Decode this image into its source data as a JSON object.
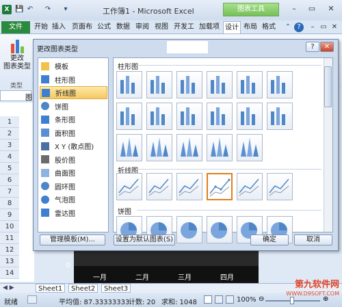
{
  "window": {
    "title": "工作簿1 - Microsoft Excel",
    "context_tab": "图表工具",
    "controls": [
      "–",
      "▭",
      "✕"
    ]
  },
  "quick_access": [
    "💾",
    "↶",
    "↷",
    "▾"
  ],
  "ribbon": {
    "tabs": [
      "文件",
      "开始",
      "插入",
      "页面布",
      "公式",
      "数据",
      "审阅",
      "视图",
      "开发工",
      "加载项",
      "设计",
      "布局",
      "格式"
    ],
    "active_tab": "设计",
    "change_type_button": "更改\n图表类型",
    "group_label": "类型"
  },
  "sheet": {
    "namebox": "图",
    "rows": [
      "1",
      "2",
      "3",
      "4",
      "5",
      "6",
      "7",
      "8",
      "9",
      "10",
      "11",
      "12",
      "13",
      "14"
    ],
    "chart_axis_zero": "0",
    "chart_months": [
      "一月",
      "二月",
      "三月",
      "四月"
    ],
    "tabs": [
      "Sheet1",
      "Sheet2",
      "Sheet3"
    ]
  },
  "status": {
    "mode": "就绪",
    "average": "平均值: 87.33333333",
    "count": "计数: 20",
    "sum": "求和: 1048",
    "zoom": "100%",
    "zoom_level": 1.0
  },
  "dialog": {
    "title": "更改图表类型",
    "help": "?",
    "close": "✕",
    "categories": [
      {
        "label": "模板",
        "icon": "folder-icon",
        "selected": false
      },
      {
        "label": "柱形图",
        "icon": "column-chart-icon",
        "selected": false
      },
      {
        "label": "折线图",
        "icon": "line-chart-icon",
        "selected": true
      },
      {
        "label": "饼图",
        "icon": "pie-chart-icon",
        "selected": false
      },
      {
        "label": "条形图",
        "icon": "bar-chart-icon",
        "selected": false
      },
      {
        "label": "面积图",
        "icon": "area-chart-icon",
        "selected": false
      },
      {
        "label": "X Y (散点图)",
        "icon": "scatter-chart-icon",
        "selected": false
      },
      {
        "label": "股价图",
        "icon": "stock-chart-icon",
        "selected": false
      },
      {
        "label": "曲面图",
        "icon": "surface-chart-icon",
        "selected": false
      },
      {
        "label": "圆环图",
        "icon": "doughnut-chart-icon",
        "selected": false
      },
      {
        "label": "气泡图",
        "icon": "bubble-chart-icon",
        "selected": false
      },
      {
        "label": "雷达图",
        "icon": "radar-chart-icon",
        "selected": false
      }
    ],
    "sections": [
      "柱形图",
      "折线图",
      "饼图"
    ],
    "manage_templates": "管理模板(M)...",
    "set_default": "设置为默认图表(S)",
    "ok": "确定",
    "cancel": "取消"
  },
  "watermark": {
    "text": "第九软件网",
    "url": "WWW.D9SOFT.COM"
  },
  "colors": {
    "accent": "#e07d1a",
    "file_tab": "#2a8a3e",
    "context_tab": "#76c058",
    "selected": "#f6c863"
  }
}
